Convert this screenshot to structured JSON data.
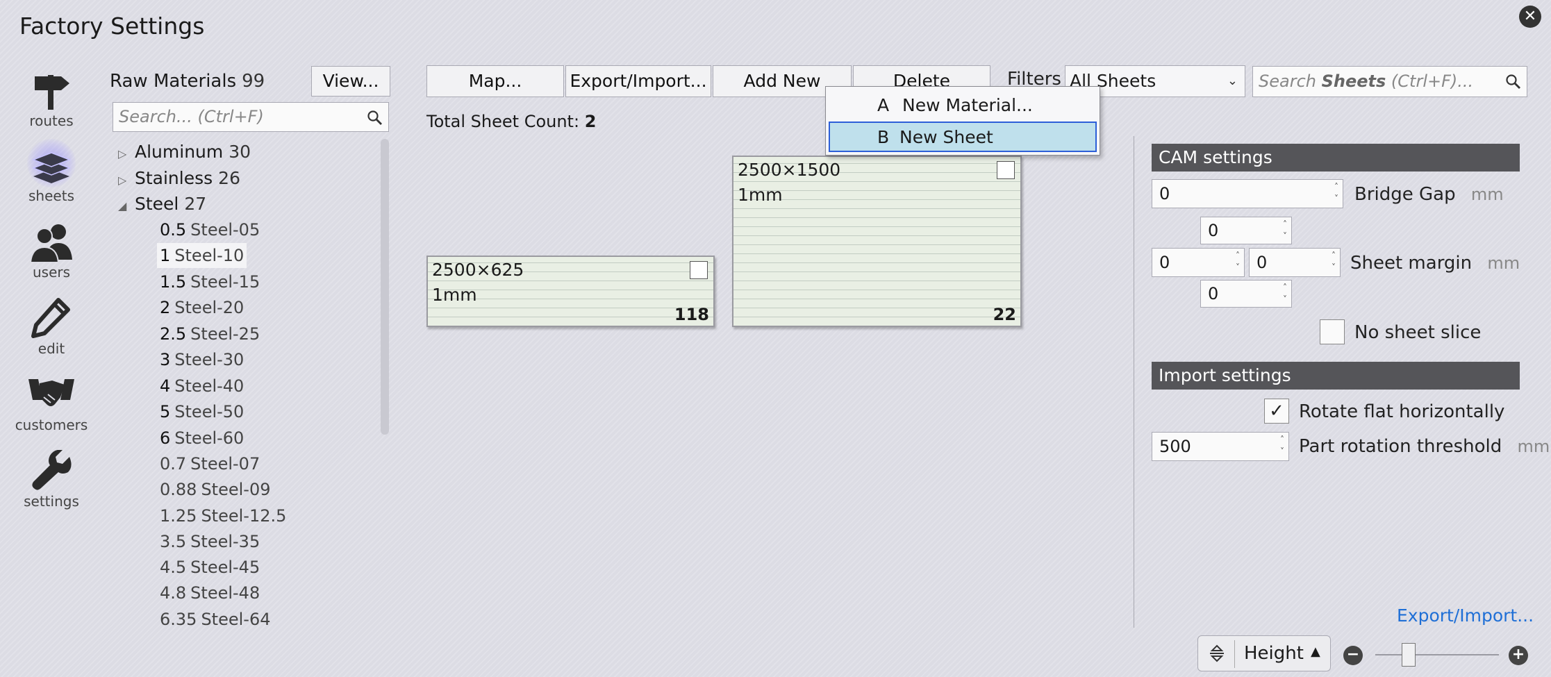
{
  "window": {
    "title": "Factory Settings"
  },
  "nav": {
    "items": [
      {
        "label": "routes",
        "icon": "signpost-icon"
      },
      {
        "label": "sheets",
        "icon": "stacked-sheets-icon",
        "active": true
      },
      {
        "label": "users",
        "icon": "users-icon"
      },
      {
        "label": "edit",
        "icon": "pencil-icon"
      },
      {
        "label": "customers",
        "icon": "handshake-icon"
      },
      {
        "label": "settings",
        "icon": "wrench-icon"
      }
    ]
  },
  "materials": {
    "title": "Raw Materials",
    "count": "99",
    "view_label": "View...",
    "search_placeholder": "Search... (Ctrl+F)",
    "groups": [
      {
        "name": "Aluminum",
        "count": "30",
        "expanded": false
      },
      {
        "name": "Stainless",
        "count": "26",
        "expanded": false
      },
      {
        "name": "Steel",
        "count": "27",
        "expanded": true
      }
    ],
    "steel_items": [
      {
        "thickness": "0.5",
        "name": "Steel-05"
      },
      {
        "thickness": "1",
        "name": "Steel-10",
        "selected": true
      },
      {
        "thickness": "1.5",
        "name": "Steel-15"
      },
      {
        "thickness": "2",
        "name": "Steel-20"
      },
      {
        "thickness": "2.5",
        "name": "Steel-25"
      },
      {
        "thickness": "3",
        "name": "Steel-30"
      },
      {
        "thickness": "4",
        "name": "Steel-40"
      },
      {
        "thickness": "5",
        "name": "Steel-50"
      },
      {
        "thickness": "6",
        "name": "Steel-60"
      },
      {
        "thickness": "0.7",
        "name": "Steel-07"
      },
      {
        "thickness": "0.88",
        "name": "Steel-09"
      },
      {
        "thickness": "1.25",
        "name": "Steel-12.5"
      },
      {
        "thickness": "3.5",
        "name": "Steel-35"
      },
      {
        "thickness": "4.5",
        "name": "Steel-45"
      },
      {
        "thickness": "4.8",
        "name": "Steel-48"
      },
      {
        "thickness": "6.35",
        "name": "Steel-64"
      }
    ]
  },
  "toolbar": {
    "map_label": "Map...",
    "export_import_label": "Export/Import...",
    "add_new_label": "Add New",
    "delete_label": "Delete",
    "filters_label": "Filters",
    "filter_value": "All Sheets",
    "search_prefix": "Search ",
    "search_bold": "Sheets",
    "search_suffix": " (Ctrl+F)..."
  },
  "add_menu": {
    "items": [
      {
        "key": "A",
        "label": "New Material..."
      },
      {
        "key": "B",
        "label": "New Sheet",
        "highlighted": true
      }
    ]
  },
  "sheets": {
    "total_label": "Total Sheet Count:",
    "total_value": "2",
    "cards": [
      {
        "dimensions": "2500×625",
        "thickness": "1mm",
        "quantity": "118"
      },
      {
        "dimensions": "2500×1500",
        "thickness": "1mm",
        "quantity": "22"
      }
    ]
  },
  "cam_settings": {
    "header": "CAM settings",
    "bridge_gap_value": "0",
    "bridge_gap_label": "Bridge Gap",
    "bridge_gap_unit": "mm",
    "margin_top": "0",
    "margin_left": "0",
    "margin_right": "0",
    "margin_bottom": "0",
    "sheet_margin_label": "Sheet margin",
    "sheet_margin_unit": "mm",
    "no_sheet_slice_label": "No sheet slice",
    "no_sheet_slice_checked": false
  },
  "import_settings": {
    "header": "Import settings",
    "rotate_flat_label": "Rotate flat horizontally",
    "rotate_flat_checked": true,
    "part_rotation_value": "500",
    "part_rotation_label": "Part rotation threshold",
    "part_rotation_unit": "mm"
  },
  "footer": {
    "export_import_link": "Export/Import...",
    "sort_label": "Height",
    "zoom_level": 0.27
  }
}
